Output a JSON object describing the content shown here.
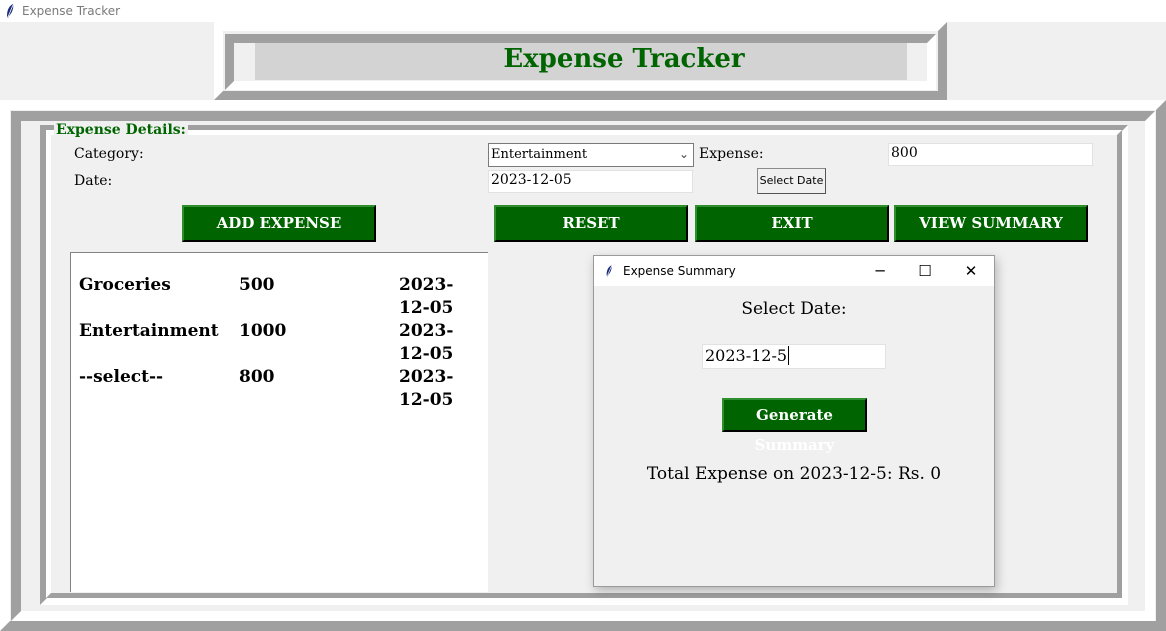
{
  "window": {
    "title": "Expense Tracker",
    "icon": "feather-icon"
  },
  "header": {
    "title": "Expense Tracker"
  },
  "details": {
    "legend": "Expense Details:",
    "category_label": "Category:",
    "category_value": "Entertainment",
    "expense_label": "Expense:",
    "expense_value": "800",
    "date_label": "Date:",
    "date_value": "2023-12-05",
    "select_date_label": "Select Date"
  },
  "buttons": {
    "add": "ADD EXPENSE",
    "reset": "RESET",
    "exit": "EXIT",
    "summary": "VIEW SUMMARY"
  },
  "expense_list": {
    "rows": [
      {
        "category": "Groceries",
        "amount": "500",
        "date": "2023-12-05"
      },
      {
        "category": "Entertainment",
        "amount": "1000",
        "date": "2023-12-05"
      },
      {
        "category": "--select--",
        "amount": "800",
        "date": "2023-12-05"
      }
    ]
  },
  "summary_dialog": {
    "title": "Expense Summary",
    "select_date_label": "Select Date:",
    "date_input": "2023-12-5",
    "generate_label": "Generate Summary",
    "total_text": "Total Expense on 2023-12-5: Rs. 0",
    "minimize_glyph": "─",
    "maximize_glyph": "☐",
    "close_glyph": "✕"
  },
  "colors": {
    "accent_green": "#006400",
    "header_band": "#d3d3d3",
    "window_bg": "#f0f0f0"
  }
}
